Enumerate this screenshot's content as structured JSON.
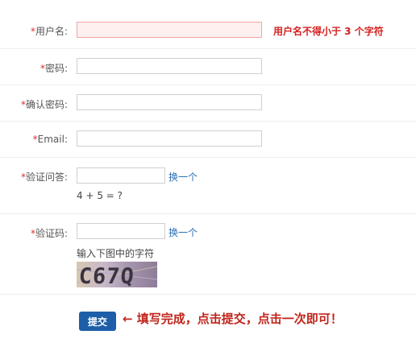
{
  "form": {
    "username": {
      "required_mark": "*",
      "label": "用户名:",
      "value": "",
      "error": "用户名不得小于 3 个字符"
    },
    "password": {
      "required_mark": "*",
      "label": "密码:",
      "value": ""
    },
    "confirm_password": {
      "required_mark": "*",
      "label": "确认密码:",
      "value": ""
    },
    "email": {
      "required_mark": "*",
      "label": "Email:",
      "value": ""
    },
    "qa": {
      "required_mark": "*",
      "label": "验证问答:",
      "value": "",
      "change_link": "换一个",
      "question": "4 + 5 = ?"
    },
    "captcha": {
      "required_mark": "*",
      "label": "验证码:",
      "value": "",
      "change_link": "换一个",
      "hint": "输入下图中的字符",
      "image_text": "C67Q"
    }
  },
  "actions": {
    "submit_label": "提交",
    "note": "← 填写完成，点击提交，点击一次即可！"
  },
  "colors": {
    "required": "#e03030",
    "error": "#d61f1f",
    "link": "#2c6fb3",
    "button": "#1d5ea8",
    "note": "#c0251c"
  }
}
